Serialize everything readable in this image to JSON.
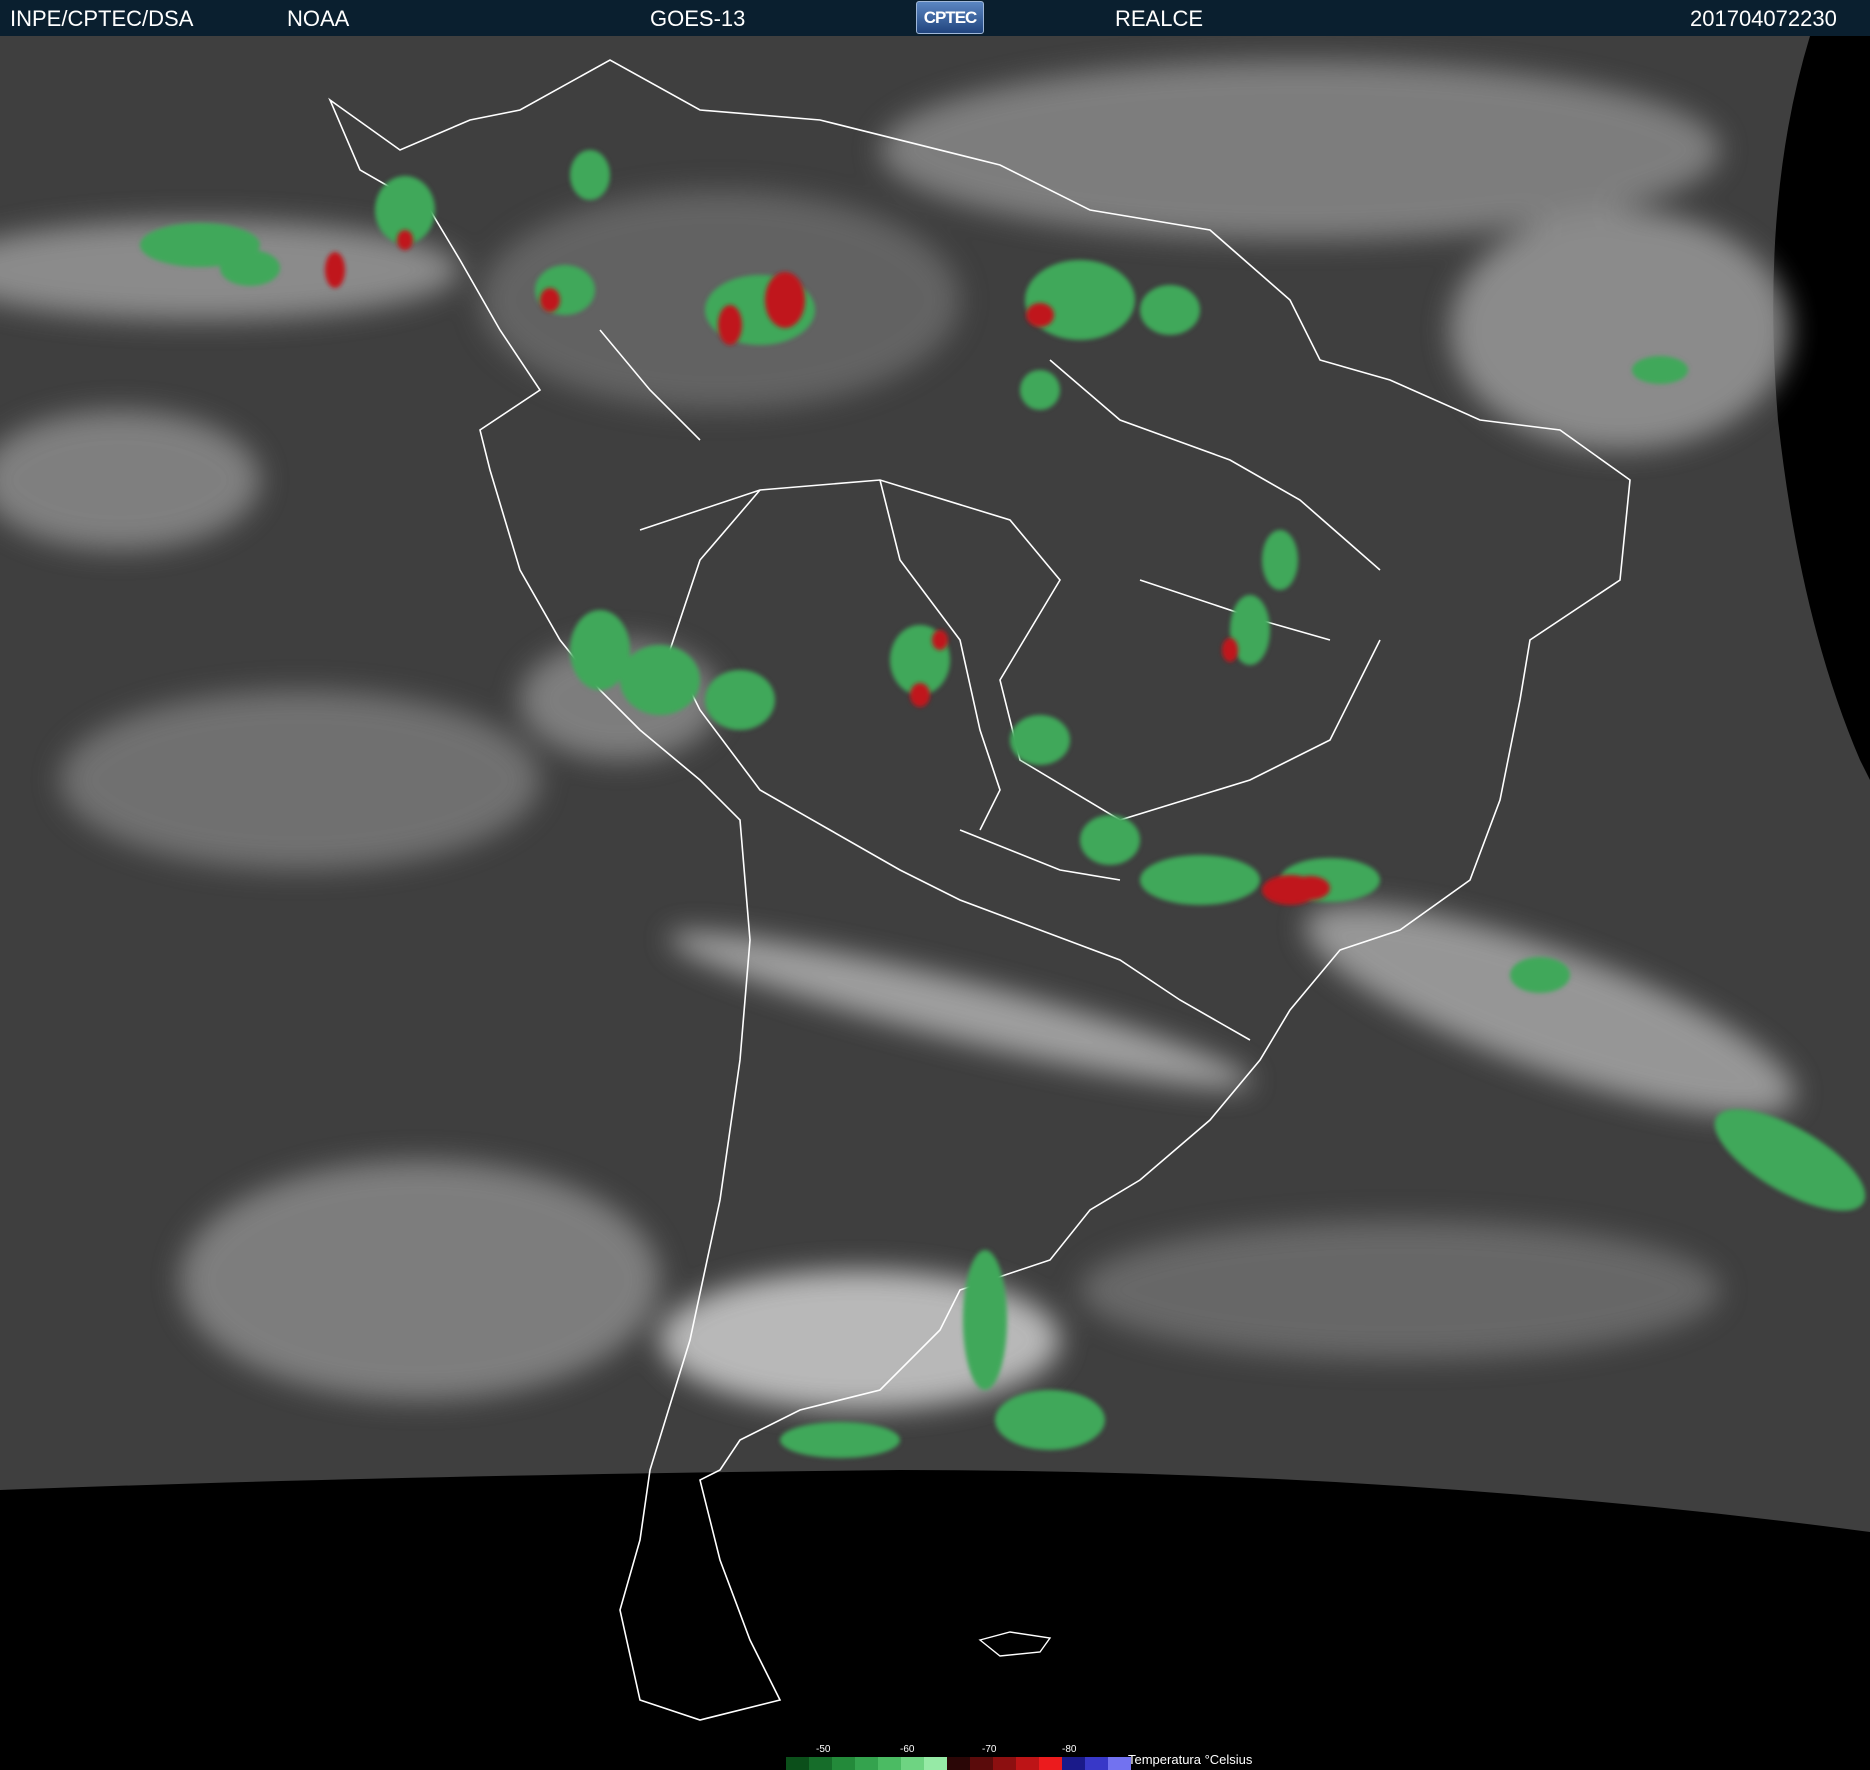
{
  "header": {
    "agency": "INPE/CPTEC/DSA",
    "source": "NOAA",
    "satellite": "GOES-13",
    "logo_text": "CPTEC",
    "product": "REALCE",
    "timestamp": "201704072230"
  },
  "legend": {
    "title": "Temperatura °Celsius",
    "ticks": [
      "-50",
      "-60",
      "-70",
      "-80"
    ],
    "colors": [
      "#0b4f1a",
      "#166d2a",
      "#238a3a",
      "#34a34e",
      "#4bbb63",
      "#6ed482",
      "#96eaa6",
      "#2a0606",
      "#5a0b0b",
      "#8c0f10",
      "#bd1416",
      "#ec1b1d",
      "#1a1a8a",
      "#3838c8",
      "#7272f0"
    ]
  },
  "colors": {
    "header_bg": "#0a1f2f",
    "space": "#000000",
    "cloud_green": "#3fa85a",
    "cloud_red": "#c0141a",
    "coastline": "#ffffff"
  }
}
